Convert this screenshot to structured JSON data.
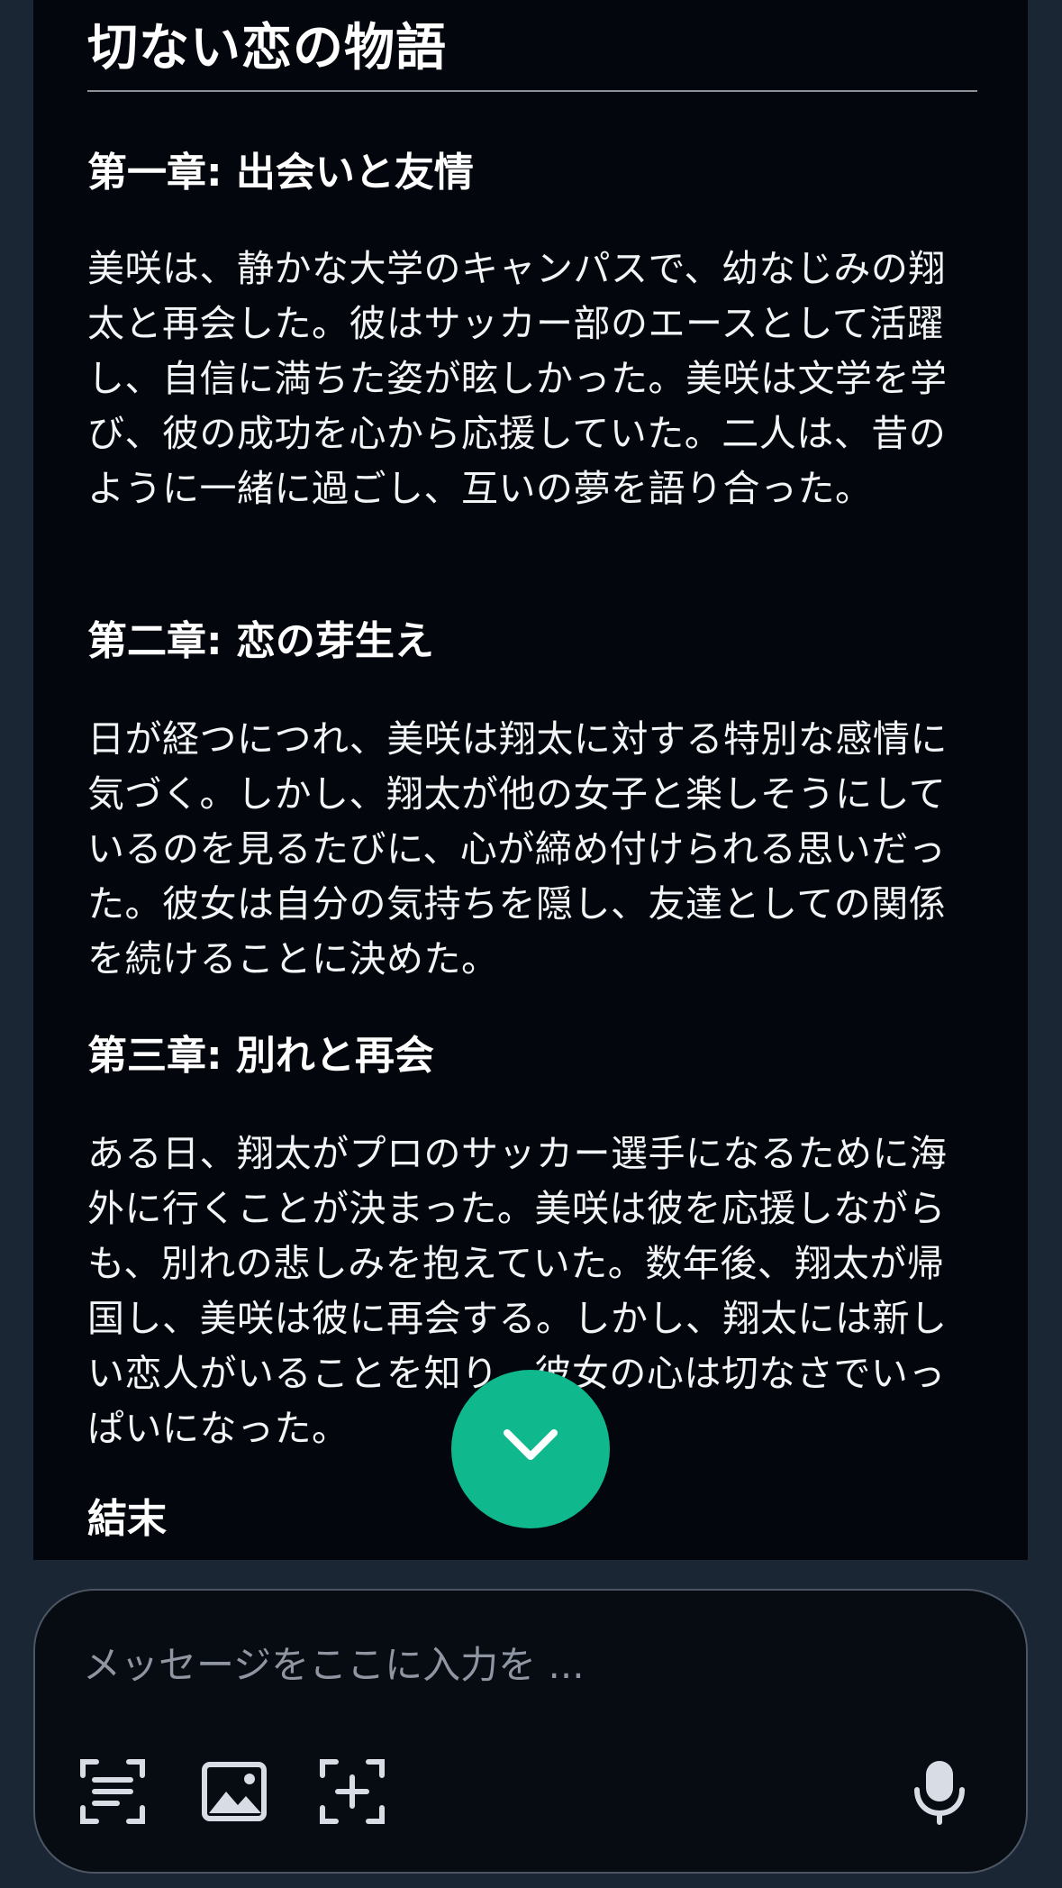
{
  "story": {
    "title": "切ない恋の物語",
    "chapters": [
      {
        "heading": "第一章: 出会いと友情",
        "text": "美咲は、静かな大学のキャンパスで、幼なじみの翔太と再会した。彼はサッカー部のエースとして活躍し、自信に満ちた姿が眩しかった。美咲は文学を学び、彼の成功を心から応援していた。二人は、昔のように一緒に過ごし、互いの夢を語り合った。"
      },
      {
        "heading": "第二章: 恋の芽生え",
        "text": "日が経つにつれ、美咲は翔太に対する特別な感情に気づく。しかし、翔太が他の女子と楽しそうにしているのを見るたびに、心が締め付けられる思いだった。彼女は自分の気持ちを隠し、友達としての関係を続けることに決めた。"
      },
      {
        "heading": "第三章: 別れと再会",
        "text": "ある日、翔太がプロのサッカー選手になるために海外に行くことが決まった。美咲は彼を応援しながらも、別れの悲しみを抱えていた。数年後、翔太が帰国し、美咲は彼に再会する。しかし、翔太には新しい恋人がいることを知り、彼女の心は切なさでいっぱいになった。"
      },
      {
        "heading": "結末"
      }
    ]
  },
  "composer": {
    "placeholder": "メッセージをここに入力を ..."
  },
  "icons": {
    "scroll_down": "chevron-down-icon",
    "scan_text": "scan-text-icon",
    "image": "image-icon",
    "frame_add": "frame-add-icon",
    "microphone": "microphone-icon"
  },
  "colors": {
    "page_background": "#1b2634",
    "message_background": "#03070d",
    "accent": "#10b88d",
    "text": "#ffffff",
    "placeholder": "#8f96a2"
  }
}
